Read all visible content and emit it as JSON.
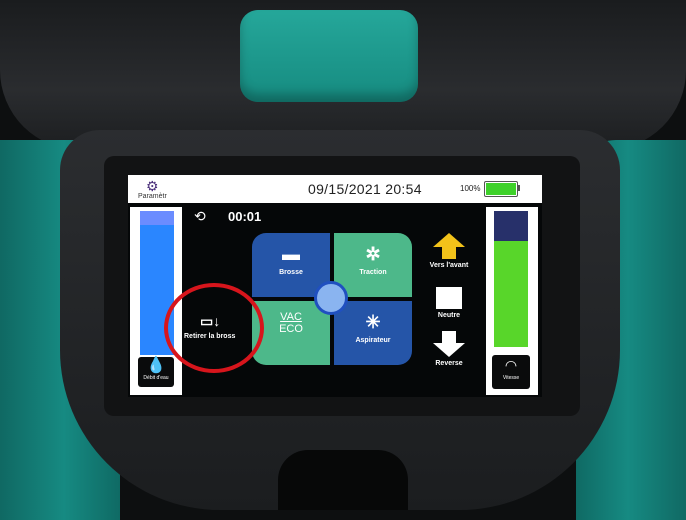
{
  "header": {
    "settings_label": "Paramètr",
    "datetime": "09/15/2021  20:54",
    "battery_percent": "100%",
    "battery_level": 1.0
  },
  "timer": {
    "value": "00:01"
  },
  "water": {
    "label": "Débit d'eau",
    "level": 0.9
  },
  "speed": {
    "label": "Vitesse",
    "level": 0.78
  },
  "functions": {
    "brush": {
      "label": "Brosse",
      "icon": "brush-icon"
    },
    "traction": {
      "label": "Traction",
      "icon": "fan-icon"
    },
    "vac": {
      "label": "VAC",
      "mode": "ECO"
    },
    "vacuum": {
      "label": "Aspirateur",
      "icon": "vacuum-icon"
    }
  },
  "remove_brush": {
    "label": "Retirer  la  bross"
  },
  "direction": {
    "forward": "Vers l'avant",
    "neutral": "Neutre",
    "reverse": "Reverse"
  },
  "colors": {
    "highlight": "#d7151c",
    "brush_quad": "#2555a8",
    "traction_quad": "#4db88a",
    "forward_arrow": "#f2c21a",
    "battery": "#3ed12a"
  }
}
